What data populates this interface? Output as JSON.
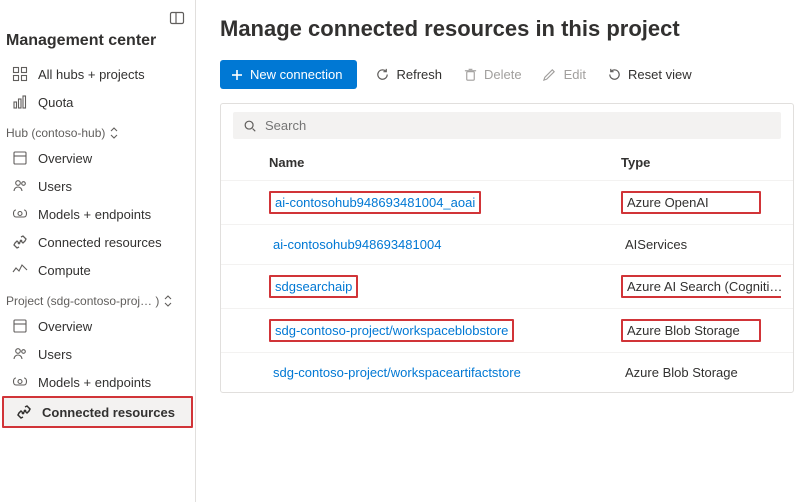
{
  "sidebar": {
    "collapse_label": "Collapse",
    "title": "Management center",
    "top_items": [
      {
        "label": "All hubs + projects"
      },
      {
        "label": "Quota"
      }
    ],
    "hub_group_label": "Hub (contoso-hub)",
    "hub_items": [
      {
        "label": "Overview"
      },
      {
        "label": "Users"
      },
      {
        "label": "Models + endpoints"
      },
      {
        "label": "Connected resources"
      },
      {
        "label": "Compute"
      }
    ],
    "project_group_label": "Project (sdg-contoso-proj… )",
    "project_items": [
      {
        "label": "Overview"
      },
      {
        "label": "Users"
      },
      {
        "label": "Models + endpoints"
      },
      {
        "label": "Connected resources"
      }
    ]
  },
  "page": {
    "title": "Manage connected resources in this project",
    "toolbar": {
      "new_connection": "New connection",
      "refresh": "Refresh",
      "delete": "Delete",
      "edit": "Edit",
      "reset_view": "Reset view"
    },
    "search_placeholder": "Search",
    "columns": {
      "name": "Name",
      "type": "Type"
    },
    "rows": [
      {
        "name": "ai-contosohub948693481004_aoai",
        "type": "Azure OpenAI",
        "highlight": true,
        "link": true
      },
      {
        "name": "ai-contosohub948693481004",
        "type": "AIServices",
        "highlight": false,
        "link": true
      },
      {
        "name": "sdgsearchaip",
        "type": "Azure AI Search (Cogniti…",
        "highlight": true,
        "link": true
      },
      {
        "name": "sdg-contoso-project/workspaceblobstore",
        "type": "Azure Blob Storage",
        "highlight": true,
        "link": true
      },
      {
        "name": "sdg-contoso-project/workspaceartifactstore",
        "type": "Azure Blob Storage",
        "highlight": false,
        "link": true
      }
    ]
  }
}
